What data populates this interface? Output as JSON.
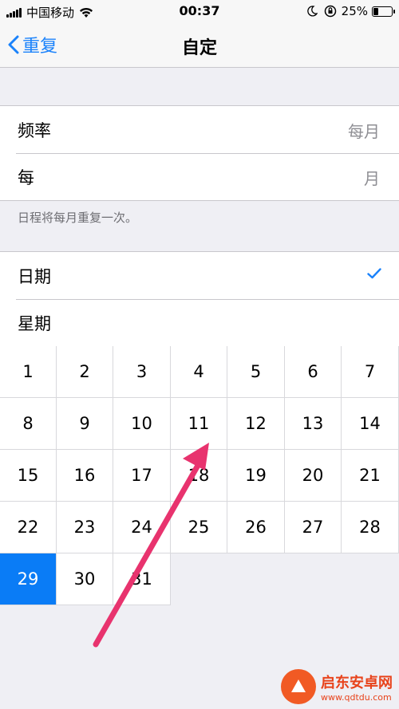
{
  "status_bar": {
    "carrier": "中国移动",
    "time": "00:37",
    "battery_percent": "25%",
    "battery_level": 0.25
  },
  "nav": {
    "back_label": "重复",
    "title": "自定"
  },
  "frequency_section": {
    "rows": [
      {
        "label": "频率",
        "value": "每月"
      },
      {
        "label": "每",
        "value": "月"
      }
    ],
    "footer": "日程将每月重复一次。"
  },
  "mode_section": {
    "rows": [
      {
        "label": "日期",
        "checked": true
      },
      {
        "label": "星期",
        "checked": false
      }
    ]
  },
  "calendar": {
    "days": [
      "1",
      "2",
      "3",
      "4",
      "5",
      "6",
      "7",
      "8",
      "9",
      "10",
      "11",
      "12",
      "13",
      "14",
      "15",
      "16",
      "17",
      "18",
      "19",
      "20",
      "21",
      "22",
      "23",
      "24",
      "25",
      "26",
      "27",
      "28",
      "29",
      "30",
      "31"
    ],
    "selected": [
      "29"
    ],
    "accent_color": "#0a7cf6"
  },
  "annotation": {
    "arrow_color": "#e8336e"
  },
  "watermark": {
    "title": "启东安卓网",
    "url": "www.qdtdu.com"
  }
}
